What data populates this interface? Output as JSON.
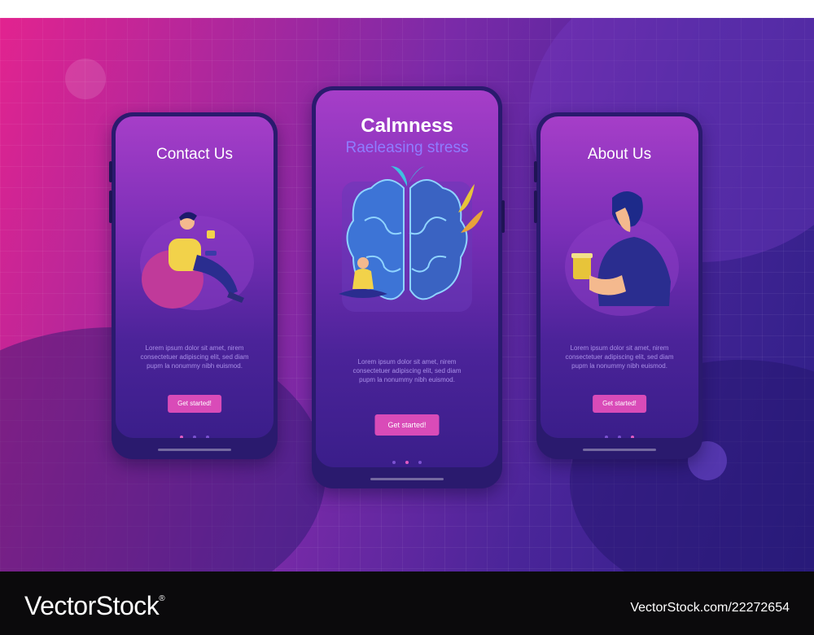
{
  "screens": {
    "left": {
      "title": "Contact Us",
      "lorem": [
        "Lorem ipsum dolor sit amet, nirem",
        "consectetuer adipiscing elit, sed diam",
        "pupm la nonummy nibh euismod."
      ],
      "button": "Get started!"
    },
    "center": {
      "title": "Calmness",
      "subtitle": "Raeleasing stress",
      "lorem": [
        "Lorem ipsum dolor sit amet, nirem",
        "consectetuer adipiscing elit, sed diam",
        "pupm la nonummy nibh euismod."
      ],
      "button": "Get started!"
    },
    "right": {
      "title": "About Us",
      "lorem": [
        "Lorem ipsum dolor sit amet, nirem",
        "consectetuer adipiscing elit, sed diam",
        "pupm la nonummy nibh euismod."
      ],
      "button": "Get started!"
    }
  },
  "pager": {
    "left_active": 0,
    "center_active": 1,
    "right_active": 2
  },
  "footer": {
    "logo": "VectorStock",
    "logo_mark": "®",
    "ref": "VectorStock.com/22272654"
  },
  "colors": {
    "accent": "#d94bb8",
    "subtitle": "#8f7cff",
    "footer_bg": "#0b0a0c"
  },
  "icons": [
    "brain-illustration",
    "meditating-person-illustration",
    "person-with-phone-illustration",
    "person-with-coffee-illustration",
    "leaf-icon"
  ]
}
